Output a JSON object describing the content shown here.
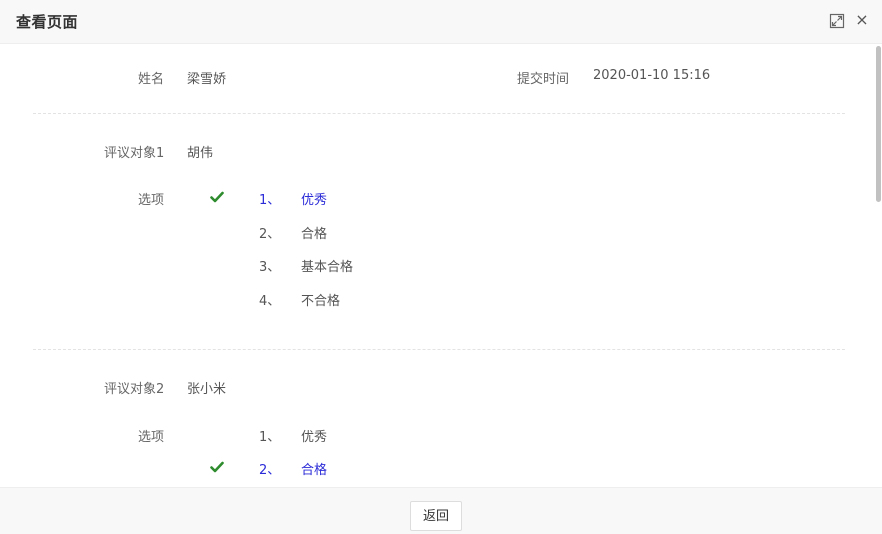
{
  "header": {
    "title": "查看页面",
    "maximize_icon": "maximize-icon",
    "close_label": "×"
  },
  "info": {
    "name_label": "姓名",
    "name_value": "梁雪娇",
    "submit_time_label": "提交时间",
    "submit_time_value": "2020-01-10 15:16"
  },
  "evaluations": [
    {
      "subject_label": "评议对象1",
      "subject_name": "胡伟",
      "options_label": "选项",
      "selected_index": 0,
      "options": [
        {
          "number": "1、",
          "text": "优秀"
        },
        {
          "number": "2、",
          "text": "合格"
        },
        {
          "number": "3、",
          "text": "基本合格"
        },
        {
          "number": "4、",
          "text": "不合格"
        }
      ]
    },
    {
      "subject_label": "评议对象2",
      "subject_name": "张小米",
      "options_label": "选项",
      "selected_index": 1,
      "options": [
        {
          "number": "1、",
          "text": "优秀"
        },
        {
          "number": "2、",
          "text": "合格"
        }
      ]
    }
  ],
  "footer": {
    "back_label": "返回"
  },
  "colors": {
    "selected": "#2b2bd8",
    "check": "#2e8b2e"
  }
}
